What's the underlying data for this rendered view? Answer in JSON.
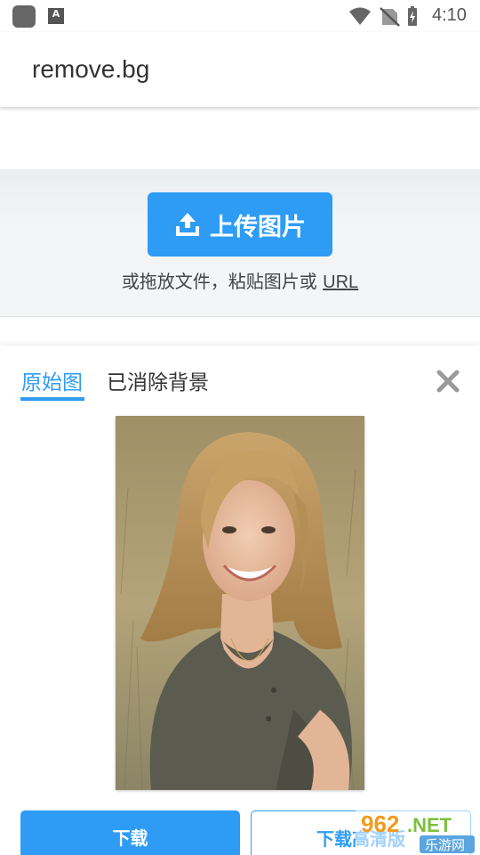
{
  "status_bar": {
    "time": "4:10",
    "keyboard_badge": "A",
    "icons": [
      "app-square-icon",
      "keyboard-a-icon",
      "wifi-icon",
      "no-sim-icon",
      "battery-charging-icon"
    ]
  },
  "app_bar": {
    "title": "remove.bg"
  },
  "upload": {
    "button_label": "上传图片",
    "hint_text": "或拖放文件，粘贴图片或 ",
    "hint_link": "URL"
  },
  "result": {
    "tabs": [
      {
        "label": "原始图",
        "active": true
      },
      {
        "label": "已消除背景",
        "active": false
      }
    ],
    "close_icon": "close-x-icon",
    "download_label": "下载",
    "download_hd_label": "下载高清版"
  },
  "watermark": {
    "top": "962.NET",
    "bottom": "乐游网"
  },
  "colors": {
    "accent": "#2e9cf5",
    "upload_bg": "#f4f5f7"
  }
}
